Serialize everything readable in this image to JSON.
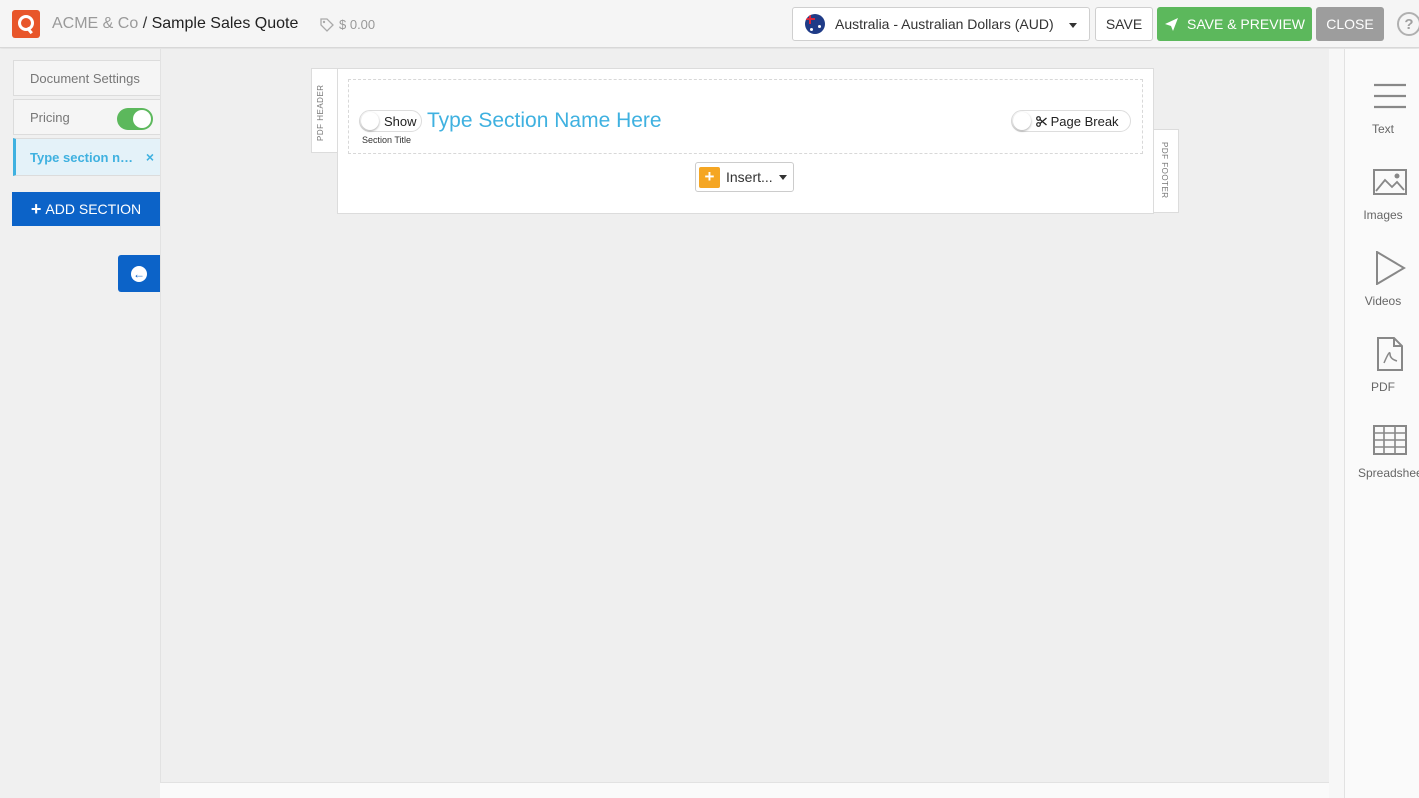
{
  "header": {
    "company": "ACME & Co",
    "separator": "/",
    "title": "Sample Sales Quote",
    "price": "$ 0.00",
    "currency": "Australia - Australian Dollars (AUD)",
    "save_label": "SAVE",
    "save_preview_label": "SAVE & PREVIEW",
    "close_label": "CLOSE",
    "help": "?",
    "colors": {
      "primary_blue": "#0c63c8",
      "green": "#5cb85c",
      "accent": "#3fb1e0",
      "brand_orange": "#e8562a"
    }
  },
  "sidebar": {
    "document_settings": "Document Settings",
    "pricing": "Pricing",
    "pricing_enabled": true,
    "section_item": "Type section n…",
    "section_close": "×",
    "add_section": "ADD SECTION",
    "add_section_icon": "+",
    "back_icon": "←"
  },
  "editor": {
    "pdf_header": "PDF HEADER",
    "pdf_footer": "PDF FOOTER",
    "show_label": "Show",
    "section_title_sub": "Section Title",
    "section_name_placeholder": "Type Section Name Here",
    "page_break_label": "Page Break",
    "insert_label": "Insert...",
    "insert_icon": "+"
  },
  "tools": [
    {
      "label": "Text",
      "icon": "text-lines-icon"
    },
    {
      "label": "Images",
      "icon": "image-icon"
    },
    {
      "label": "Videos",
      "icon": "play-icon"
    },
    {
      "label": "PDF",
      "icon": "pdf-file-icon"
    },
    {
      "label": "Spreadsheet",
      "icon": "grid-icon"
    }
  ]
}
